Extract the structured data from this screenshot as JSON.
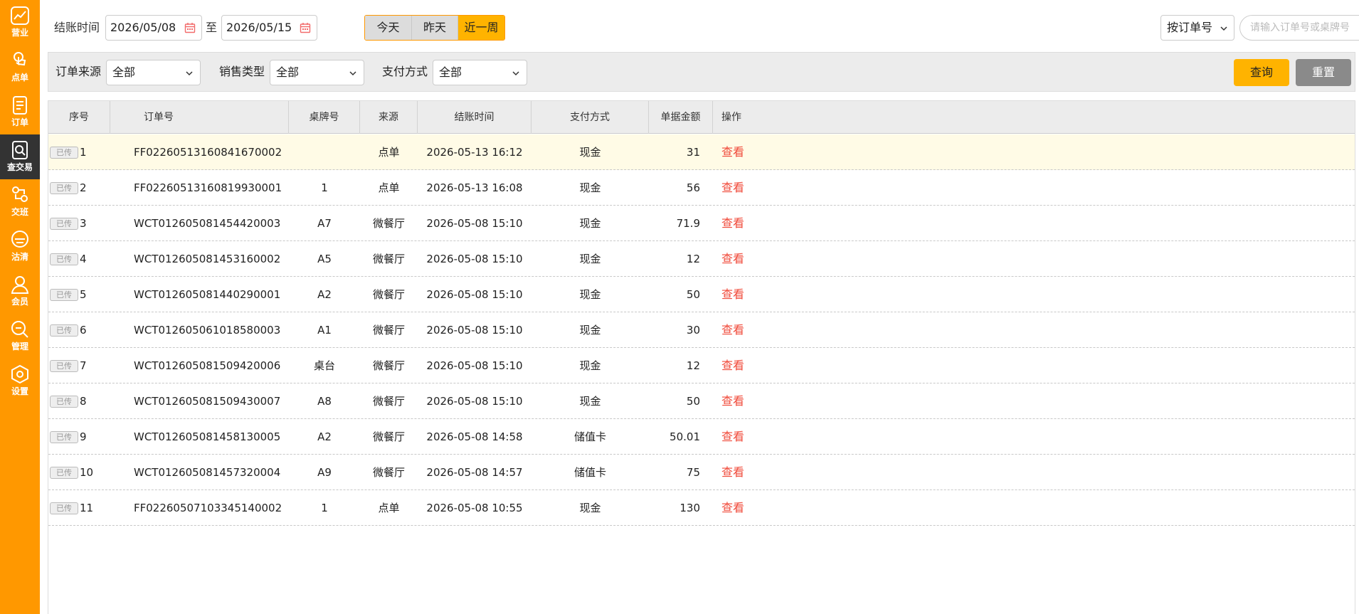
{
  "sidebar": {
    "items": [
      {
        "label": "营业",
        "icon": "chart-trend-icon",
        "active": false
      },
      {
        "label": "点单",
        "icon": "hand-pointer-icon",
        "active": false
      },
      {
        "label": "订单",
        "icon": "document-icon",
        "active": false
      },
      {
        "label": "查交易",
        "icon": "search-document-icon",
        "active": true
      },
      {
        "label": "交班",
        "icon": "shift-handover-icon",
        "active": false
      },
      {
        "label": "沽清",
        "icon": "chef-hat-icon",
        "active": false
      },
      {
        "label": "会员",
        "icon": "user-icon",
        "active": false
      },
      {
        "label": "管理",
        "icon": "wrench-icon",
        "active": false
      },
      {
        "label": "设置",
        "icon": "gear-icon",
        "active": false
      }
    ]
  },
  "toolbar": {
    "date_label": "结账时间",
    "start_date": "2026/05/08",
    "to_label": "至",
    "end_date": "2026/05/15",
    "quick_ranges": [
      {
        "label": "今天",
        "selected": false
      },
      {
        "label": "昨天",
        "selected": false
      },
      {
        "label": "近一周",
        "selected": true
      }
    ],
    "search_by": "按订单号",
    "search_placeholder": "请输入订单号或桌牌号"
  },
  "filters": {
    "source_label": "订单来源",
    "source_value": "全部",
    "sales_type_label": "销售类型",
    "sales_type_value": "全部",
    "payment_label": "支付方式",
    "payment_value": "全部",
    "query_label": "查询",
    "reset_label": "重置"
  },
  "table": {
    "columns": [
      "序号",
      "订单号",
      "桌牌号",
      "来源",
      "结账时间",
      "支付方式",
      "单据金额",
      "操作"
    ],
    "badge": "已传",
    "action_label": "查看",
    "selected_row": 0,
    "rows": [
      {
        "no": "1",
        "order": "FF02260513160841670002",
        "table": "",
        "source": "点单",
        "time": "2026-05-13 16:12",
        "pay": "现金",
        "amount": "31"
      },
      {
        "no": "2",
        "order": "FF02260513160819930001",
        "table": "1",
        "source": "点单",
        "time": "2026-05-13 16:08",
        "pay": "现金",
        "amount": "56"
      },
      {
        "no": "3",
        "order": "WCT012605081454420003",
        "table": "A7",
        "source": "微餐厅",
        "time": "2026-05-08 15:10",
        "pay": "现金",
        "amount": "71.9"
      },
      {
        "no": "4",
        "order": "WCT012605081453160002",
        "table": "A5",
        "source": "微餐厅",
        "time": "2026-05-08 15:10",
        "pay": "现金",
        "amount": "12"
      },
      {
        "no": "5",
        "order": "WCT012605081440290001",
        "table": "A2",
        "source": "微餐厅",
        "time": "2026-05-08 15:10",
        "pay": "现金",
        "amount": "50"
      },
      {
        "no": "6",
        "order": "WCT012605061018580003",
        "table": "A1",
        "source": "微餐厅",
        "time": "2026-05-08 15:10",
        "pay": "现金",
        "amount": "30"
      },
      {
        "no": "7",
        "order": "WCT012605081509420006",
        "table": "桌台",
        "source": "微餐厅",
        "time": "2026-05-08 15:10",
        "pay": "现金",
        "amount": "12"
      },
      {
        "no": "8",
        "order": "WCT012605081509430007",
        "table": "A8",
        "source": "微餐厅",
        "time": "2026-05-08 15:10",
        "pay": "现金",
        "amount": "50"
      },
      {
        "no": "9",
        "order": "WCT012605081458130005",
        "table": "A2",
        "source": "微餐厅",
        "time": "2026-05-08 14:58",
        "pay": "储值卡",
        "amount": "50.01"
      },
      {
        "no": "10",
        "order": "WCT012605081457320004",
        "table": "A9",
        "source": "微餐厅",
        "time": "2026-05-08 14:57",
        "pay": "储值卡",
        "amount": "75"
      },
      {
        "no": "11",
        "order": "FF02260507103345140002",
        "table": "1",
        "source": "点单",
        "time": "2026-05-08 10:55",
        "pay": "现金",
        "amount": "130"
      }
    ]
  },
  "colors": {
    "accent": "#ff9800",
    "active_nav": "#333333",
    "link": "#f04a3a",
    "query_button": "#ffb300",
    "reset_button": "#8a8a8a"
  }
}
